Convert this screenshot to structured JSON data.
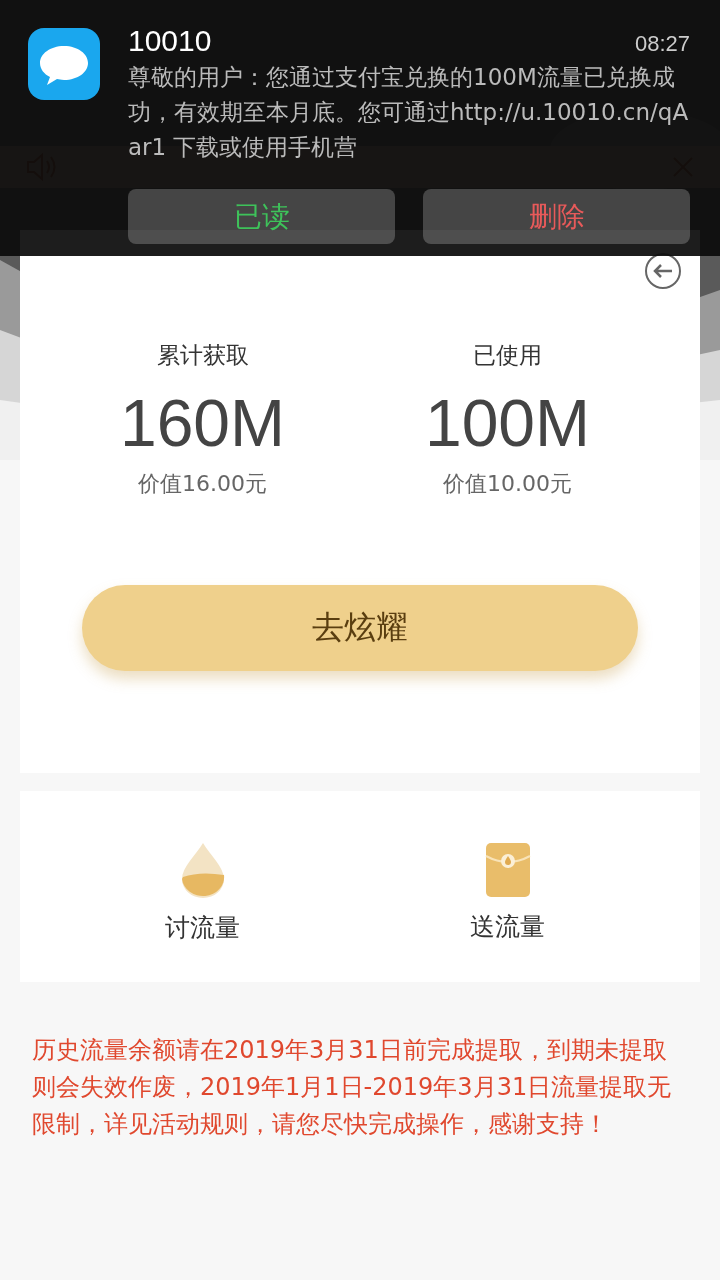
{
  "notification": {
    "sender": "10010",
    "time": "08:27",
    "message": "尊敬的用户：您通过支付宝兑换的100M流量已兑换成功，有效期至本月底。您可通过http://u.10010.cn/qAar1 下载或使用手机营",
    "actions": [
      {
        "label": "已读",
        "kind": "read"
      },
      {
        "label": "删除",
        "kind": "delete"
      }
    ]
  },
  "stats": [
    {
      "label": "累计获取",
      "value": "160M",
      "worth": "价值16.00元"
    },
    {
      "label": "已使用",
      "value": "100M",
      "worth": "价值10.00元"
    }
  ],
  "show_off_button": "去炫耀",
  "actions": [
    {
      "label": "讨流量",
      "kind": "drop"
    },
    {
      "label": "送流量",
      "kind": "envelope"
    }
  ],
  "notice": "历史流量余额请在2019年3月31日前完成提取，到期未提取则会失效作废，2019年1月1日-2019年3月31日流量提取无限制，详见活动规则，请您尽快完成操作，感谢支持！"
}
